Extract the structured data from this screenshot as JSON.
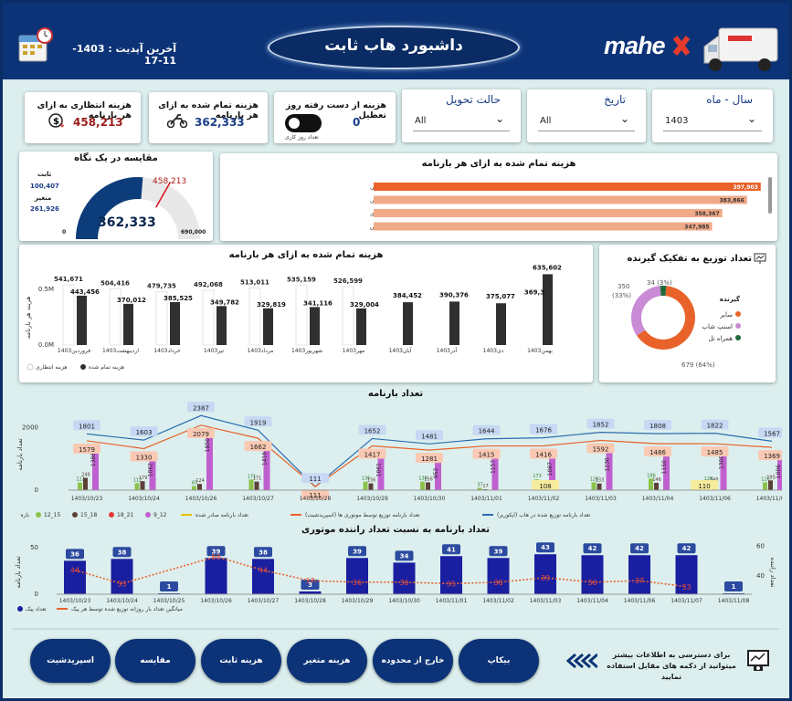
{
  "header": {
    "title": "داشبورد هاب ثابت",
    "last_update_label": "آخرین آپدیت :",
    "last_update_value": "1403-11-17",
    "logo_text": "mahex"
  },
  "kpis": {
    "pending": {
      "label": "هزینه انتظاری به ازای هر بارنامه",
      "value": "458,213",
      "color": "#9b1c1c"
    },
    "finished": {
      "label": "هزینه تمام شده به ازای هر بارنامه",
      "value": "362,333",
      "color": "#1a3d86"
    },
    "lost": {
      "label": "هزینه از دست رفته روز تعطیل",
      "value": "0",
      "toggle_label": "تعداد روز کاری"
    }
  },
  "slicers": {
    "delivery": {
      "label": "حالت تحویل",
      "value": "All"
    },
    "date": {
      "label": "تاریخ",
      "value": "All"
    },
    "year_month": {
      "label": "سال - ماه",
      "value": "1403"
    }
  },
  "gauge": {
    "title": "مقایسه در یک نگاه",
    "fixed_label": "ثابت",
    "fixed_value": "100,407",
    "variable_label": "متغیر",
    "variable_value": "261,926",
    "value": "362,333",
    "target": "458,213",
    "min": "0",
    "max": "690,000",
    "value_num": 362333,
    "target_num": 458213,
    "max_num": 690000
  },
  "branch_bars": {
    "title": "هزینه تمام شده به ازای هر بارنامه",
    "items": [
      {
        "label": "تهران - شعبه توزیع جنت آباد شمالی",
        "value": 397903,
        "text": "397,903",
        "color": "#e8622a"
      },
      {
        "label": "تهران - شعبه توزیع جیحون",
        "value": 383866,
        "text": "383,866",
        "color": "#f0aa88"
      },
      {
        "label": "تهران - شعبه توزیع سهروردی",
        "value": 358367,
        "text": "358,367",
        "color": "#f0aa88"
      },
      {
        "label": "تهران - شعبه توزیع تهرانپارس",
        "value": 347985,
        "text": "347,985",
        "color": "#f0aa88"
      }
    ]
  },
  "monthly_chart": {
    "title": "هزینه تمام شده به ازای هر بارنامه",
    "ylabel": "هزینه هر بارنامه",
    "yticks": [
      "0.0M",
      "0.5M"
    ],
    "legend": {
      "expected": "هزینه انتظاری",
      "finished": "هزینه تمام شده"
    },
    "months": [
      {
        "name": "فروردین1403",
        "expected": "541,671",
        "finished": "443,456",
        "e": 541671,
        "f": 443456
      },
      {
        "name": "اردیبهشت1403",
        "expected": "504,416",
        "finished": "370,012",
        "e": 504416,
        "f": 370012
      },
      {
        "name": "خرداد1403",
        "expected": "479,735",
        "finished": "385,525",
        "e": 479735,
        "f": 385525
      },
      {
        "name": "تیر1403",
        "expected": "492,068",
        "finished": "349,782",
        "e": 492068,
        "f": 349782
      },
      {
        "name": "مرداد1403",
        "expected": "513,011",
        "finished": "329,819",
        "e": 513011,
        "f": 329819
      },
      {
        "name": "شهریور1403",
        "expected": "535,159",
        "finished": "341,116",
        "e": 535159,
        "f": 341116
      },
      {
        "name": "مهر1403",
        "expected": "526,599",
        "finished": "329,004",
        "e": 526599,
        "f": 329004
      },
      {
        "name": "آبان1403",
        "expected": "",
        "finished": "384,452",
        "e": 0,
        "f": 384452
      },
      {
        "name": "آذر1403",
        "expected": "",
        "finished": "390,376",
        "e": 0,
        "f": 390376
      },
      {
        "name": "دی1403",
        "expected": "",
        "finished": "375,077",
        "e": 0,
        "f": 375077
      },
      {
        "name": "بهمن1403",
        "expected": "",
        "finished": "635,602",
        "e": 0,
        "f": 635602,
        "label2": "369,3"
      }
    ]
  },
  "donut": {
    "title": "تعداد توزیع به تفکیک گیرنده",
    "legend_title": "گیرنده",
    "slices": [
      {
        "name": "سایر",
        "value": 679,
        "label": "679 (64%)",
        "color": "#e8622a"
      },
      {
        "name": "اسنپ شاپ",
        "value": 350,
        "label": "350 (33%)",
        "color": "#c98ad6"
      },
      {
        "name": "همراه تل",
        "value": 34,
        "label": "34 (3%)",
        "color": "#1e6b3a"
      }
    ],
    "label_top": "34 (3%)",
    "label_left": "350",
    "label_left2": "(33%)"
  },
  "waybill_chart": {
    "title": "تعداد بارنامه",
    "ylabel": "تعداد بارنامه",
    "yticks": [
      "0",
      "2000"
    ],
    "dates": [
      "1403/10/23",
      "1403/10/24",
      "1403/10/26",
      "1403/10/27",
      "1403/10/28",
      "1403/10/29",
      "1403/10/30",
      "1403/11/01",
      "1403/11/02",
      "1403/11/03",
      "1403/11/04",
      "1403/11/06",
      "1403/11/07"
    ],
    "total": [
      1801,
      1603,
      2387,
      1919,
      111,
      1652,
      1481,
      1644,
      1676,
      1852,
      1808,
      1822,
      1567
    ],
    "orange": [
      1579,
      1330,
      2079,
      1662,
      111,
      1417,
      1281,
      1415,
      1416,
      1592,
      1486,
      1485,
      1369
    ],
    "purple": [
      1388,
      1062,
      1850,
      1416,
      19,
      1061,
      952,
      1157,
      1087,
      1230,
      1150,
      1300,
      1006
    ],
    "green1": [
      122,
      112,
      65,
      171,
      0,
      136,
      136,
      37,
      173,
      126,
      186,
      128,
      126
    ],
    "green2": [
      246,
      179,
      124,
      171,
      0,
      136,
      156,
      17,
      11,
      133,
      146,
      148,
      195
    ],
    "extra": {
      "108": "108",
      "110": "110"
    },
    "legend": [
      "12_15",
      "15_18",
      "18_21",
      "9_12",
      "بازه",
      "تعداد بارنامه صادر شده",
      "تعداد بارنامه توزیع توسط موتوری ها (اسپریدشیت)",
      "تعداد بارنامه توزیع شده در هاب (اپکوریز)"
    ]
  },
  "rider_chart": {
    "title": "تعداد بارنامه به نسبت تعداد راننده موتوری",
    "ylabel_left": "تعداد بارنامه",
    "ylabel_right": "تعداد راننده",
    "left_ticks": [
      "50",
      "0"
    ],
    "right_ticks": [
      "60",
      "40"
    ],
    "dates": [
      "1403/10/23",
      "1403/10/24",
      "1403/10/25",
      "1403/10/26",
      "1403/10/27",
      "1403/10/28",
      "1403/10/29",
      "1403/10/30",
      "1403/11/01",
      "1403/11/02",
      "1403/11/03",
      "1403/11/04",
      "1403/11/06",
      "1403/11/07",
      "1403/11/08"
    ],
    "peak": [
      36,
      38,
      1,
      39,
      38,
      3,
      39,
      34,
      41,
      39,
      43,
      42,
      42,
      42,
      1
    ],
    "avg": [
      44,
      35,
      null,
      53,
      44,
      37,
      36,
      36,
      35,
      36,
      39,
      36,
      37,
      33,
      null
    ],
    "legend_peak": "تعداد پیک",
    "legend_avg": "میانگین تعداد بار روزانه توزیع شده توسط هر پیک"
  },
  "nav": {
    "buttons": [
      "اسپریدشیت",
      "مقایسه",
      "هزینه ثابت",
      "هزینه متغیر",
      "خارج از محدوده",
      "بیکاپ"
    ],
    "hint": "برای دسترسی به اطلاعات بیشتر میتوانید از دکمه های مقابل استفاده نمایید"
  }
}
